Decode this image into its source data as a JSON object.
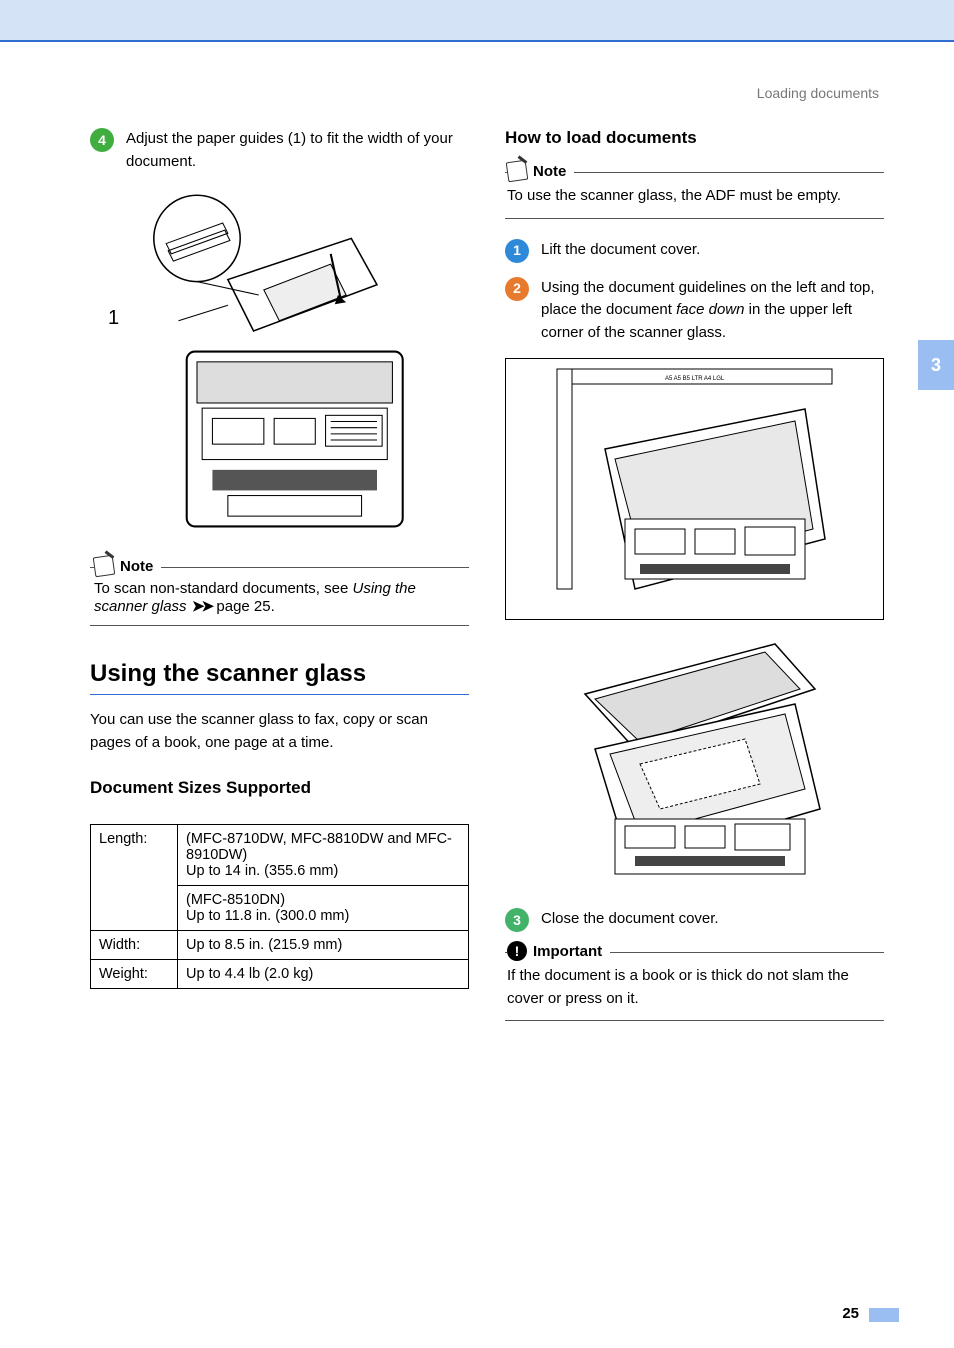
{
  "breadcrumb": "Loading documents",
  "side_tab": "3",
  "page_number": "25",
  "left": {
    "step4": {
      "num": "4",
      "text_a": "Adjust the paper guides (1) to fit the width of your document."
    },
    "callout_1": "1",
    "note": {
      "label": "Note",
      "line1": "To scan non-standard documents, see ",
      "italic": "Using the scanner glass",
      "suffix": " page 25."
    },
    "section_title": "Using the scanner glass",
    "intro": "You can use the scanner glass to fax, copy or scan pages of a book, one page at a time.",
    "sizes_heading": "Document Sizes Supported",
    "table": {
      "r1c1": "Length:",
      "r1c2": "(MFC-8710DW, MFC-8810DW and MFC-8910DW)\nUp to 14 in. (355.6 mm)",
      "r2c2": "(MFC-8510DN)\nUp to 11.8 in. (300.0 mm)",
      "r3c1": "Width:",
      "r3c2": "Up to 8.5 in. (215.9 mm)",
      "r4c1": "Weight:",
      "r4c2": "Up to 4.4 lb (2.0 kg)"
    }
  },
  "right": {
    "heading": "How to load documents",
    "note": {
      "label": "Note",
      "text": "To use the scanner glass, the ADF must be empty."
    },
    "step1": {
      "num": "1",
      "text": "Lift the document cover."
    },
    "step2": {
      "num": "2",
      "text_a": "Using the document guidelines on the left and top, place the document ",
      "italic": "face down",
      "text_b": " in the upper left corner of the scanner glass."
    },
    "step3": {
      "num": "3",
      "text": "Close the document cover."
    },
    "important": {
      "label": "Important",
      "text": "If the document is a book or is thick do not slam the cover or press on it."
    }
  }
}
